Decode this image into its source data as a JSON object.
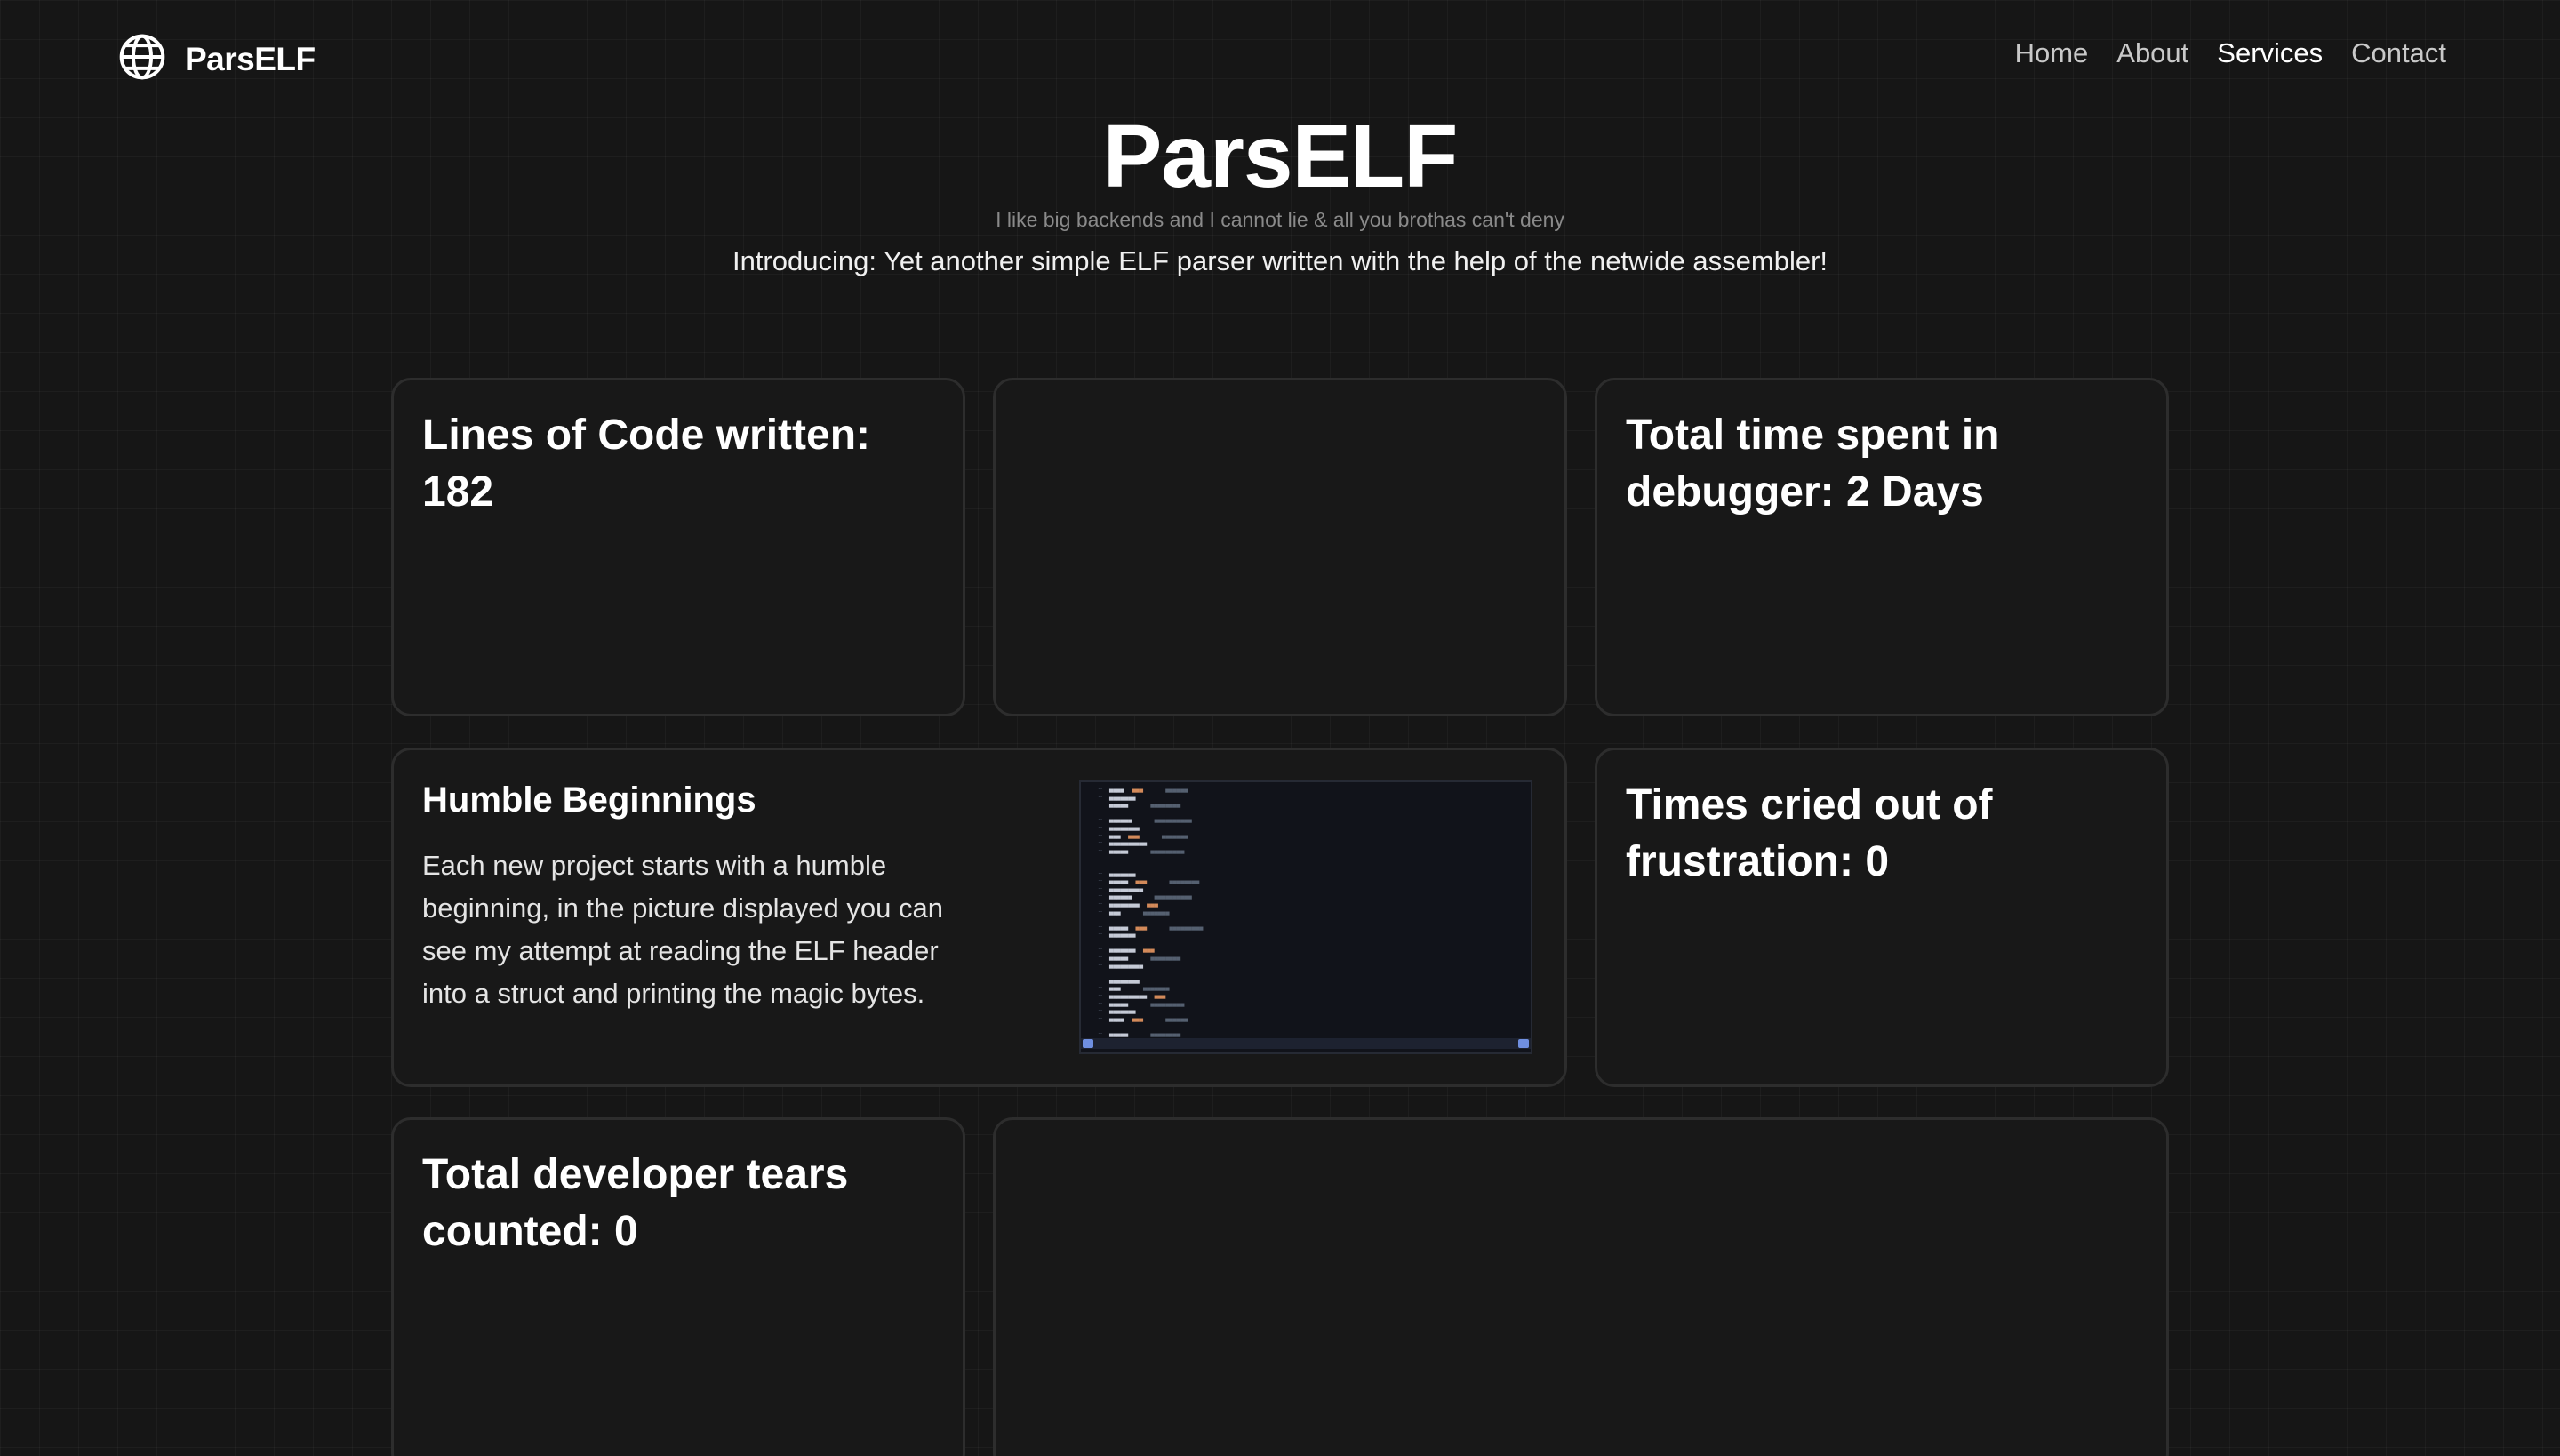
{
  "nav": {
    "brand": "ParsELF",
    "links": [
      {
        "label": "Home"
      },
      {
        "label": "About"
      },
      {
        "label": "Services"
      },
      {
        "label": "Contact"
      }
    ]
  },
  "hero": {
    "title": "ParsELF",
    "tagline": "I like big backends and I cannot lie & all you brothas can't deny",
    "intro": "Introducing: Yet another simple ELF parser written with the help of the netwide assembler!"
  },
  "cards": {
    "lines_of_code": "Lines of Code written: 182",
    "debugger_time": "Total time spent in debugger: 2 Days",
    "cried": "Times cried out of frustration: 0",
    "tears": "Total developer tears counted: 0",
    "feature": {
      "title": "Humble Beginnings",
      "text": "Each new project starts with a humble beginning, in the picture displayed you can see my attempt at reading the ELF header into a struct and printing the magic bytes."
    }
  },
  "colors": {
    "background": "#161616",
    "card": "#181818",
    "card_border": "#2d2d2d",
    "accent": "#6f8fe0"
  },
  "icons": {
    "brand": "globe-icon"
  }
}
